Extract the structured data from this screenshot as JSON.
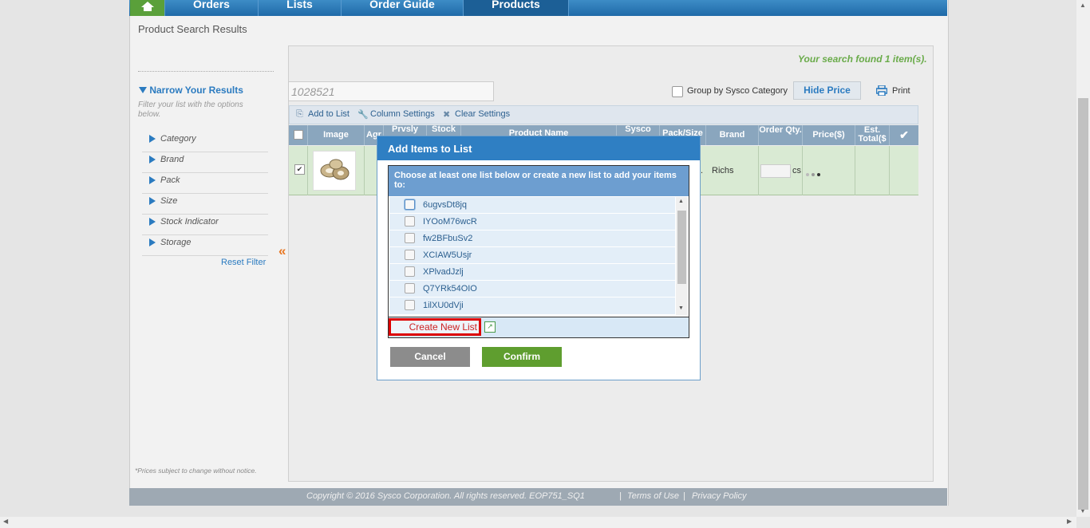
{
  "nav": {
    "tabs": [
      {
        "label": ""
      },
      {
        "label": "Orders"
      },
      {
        "label": "Lists"
      },
      {
        "label": "Order Guide"
      },
      {
        "label": "Products"
      }
    ]
  },
  "page_title": "Product Search Results",
  "sidebar": {
    "title": "Narrow Your Results",
    "description": "Filter your list with the options below.",
    "facets": [
      "Category",
      "Brand",
      "Pack",
      "Size",
      "Stock Indicator",
      "Storage"
    ],
    "reset_label": "Reset Filter",
    "collapse_glyph": "«",
    "prices_note": "*Prices subject to change without notice."
  },
  "results": {
    "found_text": "Your search found 1 item(s).",
    "search_value": "1028521",
    "group_label": "Group by Sysco Category",
    "hide_price_label": "Hide Price",
    "print_label": "Print"
  },
  "toolbar": {
    "add_to_list": "Add to List",
    "column_settings": "Column Settings",
    "clear_settings": "Clear Settings"
  },
  "grid": {
    "headers": [
      "Image",
      "Agr",
      "Prvsly",
      "Stock",
      "Product Name",
      "Sysco",
      "Pack/Size",
      "Brand",
      "Order Qty.",
      "Price($)",
      "Est. Total($"
    ],
    "row": {
      "brand": "Richs",
      "unit": "cs",
      "pack_ellipsis": "..",
      "checked": true
    }
  },
  "modal": {
    "title": "Add Items to List",
    "instruction": "Choose at least one list below or create a new list to add your items to:",
    "lists": [
      "6ugvsDt8jq",
      "IYOoM76wcR",
      "fw2BFbuSv2",
      "XCIAW5Usjr",
      "XPlvadJzlj",
      "Q7YRk54OIO",
      "1ilXU0dVji"
    ],
    "create_new_label": "Create New List",
    "cancel_label": "Cancel",
    "confirm_label": "Confirm"
  },
  "footer": {
    "copyright": "Copyright © 2016 Sysco Corporation. All rights reserved. EOP751_SQ1",
    "sep": "|",
    "terms": "Terms of Use",
    "privacy": "Privacy Policy"
  },
  "colors": {
    "brand_blue": "#2f7fc3",
    "nav_green": "#5aa03a",
    "confirm_green": "#5f9e2f",
    "row_green": "#d9ead3",
    "alert_red": "#dd0000"
  }
}
